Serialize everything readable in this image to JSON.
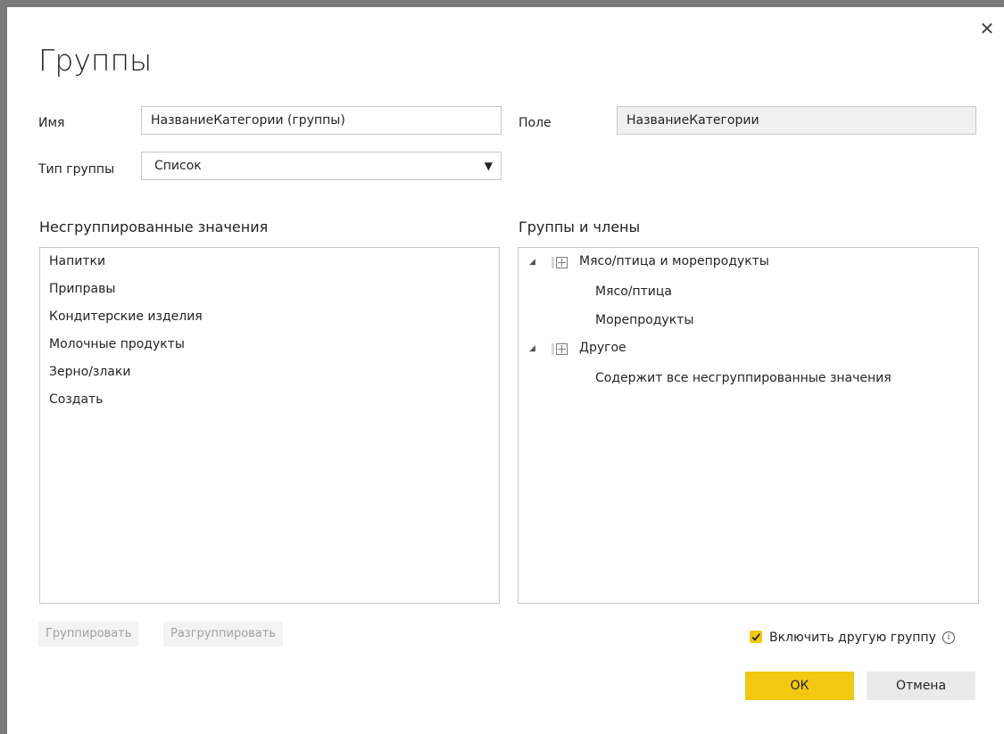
{
  "dialog": {
    "title": "Группы",
    "close_icon": "✕"
  },
  "form": {
    "name_label": "Имя",
    "name_value": "НазваниеКатегории (группы)",
    "field_label": "Поле",
    "field_value": "НазваниеКатегории",
    "group_type_label": "Тип группы",
    "group_type_value": "Список",
    "dropdown_icon": "▼"
  },
  "ungrouped": {
    "header": "Несгруппированные значения",
    "items": [
      "Напитки",
      "Приправы",
      "Кондитерские изделия",
      "Молочные продукты",
      "Зерно/злаки",
      "Создать"
    ]
  },
  "groups": {
    "header": "Группы и члены",
    "tree": [
      {
        "label": "Мясо/птица и морепродукты",
        "members": [
          "Мясо/птица",
          "Морепродукты"
        ]
      },
      {
        "label": "Другое",
        "members": [
          "Содержит все несгруппированные значения"
        ]
      }
    ]
  },
  "buttons": {
    "group": "Группировать",
    "ungroup": "Разгруппировать",
    "ok": "ОК",
    "cancel": "Отмена"
  },
  "include_other": {
    "label": "Включить другую группу",
    "checked": true,
    "info_icon": "i"
  },
  "colors": {
    "accent": "#f2c811",
    "frame": "#7a7a7a"
  }
}
